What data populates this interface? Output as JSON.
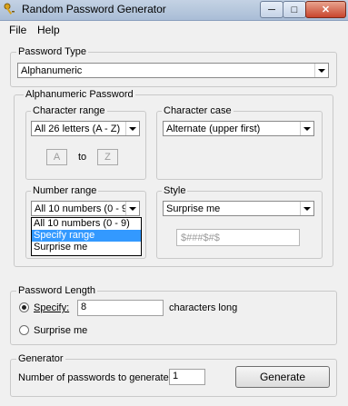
{
  "window": {
    "title": "Random Password Generator",
    "app_icon": "keys-icon"
  },
  "menu": {
    "items": [
      "File",
      "Help"
    ]
  },
  "password_type": {
    "label": "Password Type",
    "value": "Alphanumeric"
  },
  "alnum": {
    "label": "Alphanumeric Password",
    "char_range": {
      "label": "Character range",
      "value": "All 26 letters (A - Z)",
      "from": "A",
      "to_label": "to",
      "to": "Z"
    },
    "char_case": {
      "label": "Character case",
      "value": "Alternate (upper first)"
    },
    "number_range": {
      "label": "Number range",
      "value": "All 10 numbers (0 - 9",
      "options": [
        "All 10 numbers (0 - 9)",
        "Specify range",
        "Surprise me"
      ],
      "selected_index": 1
    },
    "style": {
      "label": "Style",
      "value": "Surprise me",
      "preview": "$###$#$"
    }
  },
  "length": {
    "label": "Password Length",
    "specify_label": "Specify:",
    "specify_value": "8",
    "suffix": "characters long",
    "surprise_label": "Surprise me",
    "selected": "specify"
  },
  "generator": {
    "label": "Generator",
    "count_label": "Number of passwords to generate:",
    "count_value": "1",
    "button": "Generate"
  }
}
